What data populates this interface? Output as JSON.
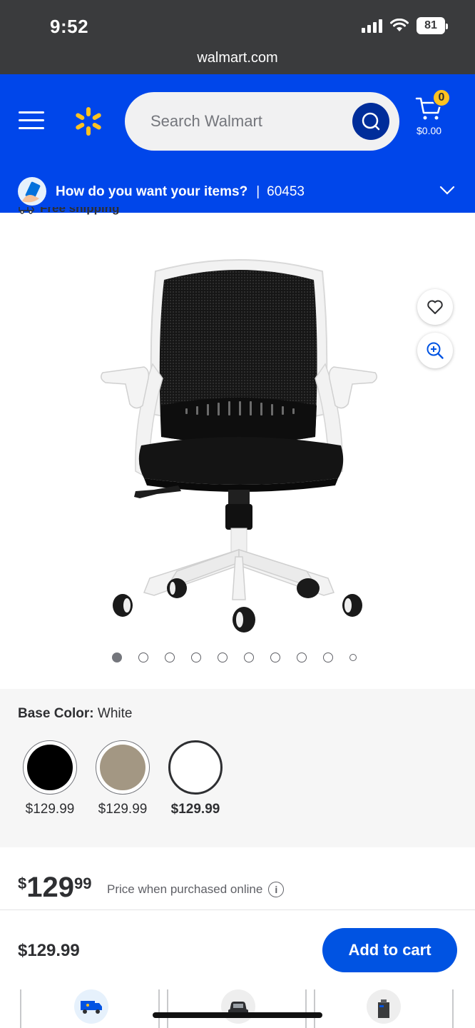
{
  "status_bar": {
    "time": "9:52",
    "battery": "81",
    "url": "walmart.com"
  },
  "header": {
    "search_placeholder": "Search Walmart",
    "cart_count": "0",
    "cart_total": "$0.00",
    "brand_color": "#0046ea",
    "spark_color": "#ffc220"
  },
  "delivery": {
    "question": "How do you want your items?",
    "separator": "|",
    "zip": "60453"
  },
  "shipping": {
    "label": "Free shipping"
  },
  "gallery": {
    "image_count": 10,
    "active_index": 0
  },
  "variant": {
    "label": "Base Color:",
    "selected": "White",
    "options": [
      {
        "color": "#000000",
        "price": "$129.99"
      },
      {
        "color": "#a39783",
        "price": "$129.99"
      },
      {
        "color": "#ffffff",
        "price": "$129.99"
      }
    ]
  },
  "price": {
    "currency": "$",
    "whole": "129",
    "cents": "99",
    "note": "Price when purchased online",
    "info_icon": "i"
  },
  "cart_bar": {
    "price": "$129.99",
    "add_label": "Add to cart",
    "button_color": "#0053e2"
  }
}
